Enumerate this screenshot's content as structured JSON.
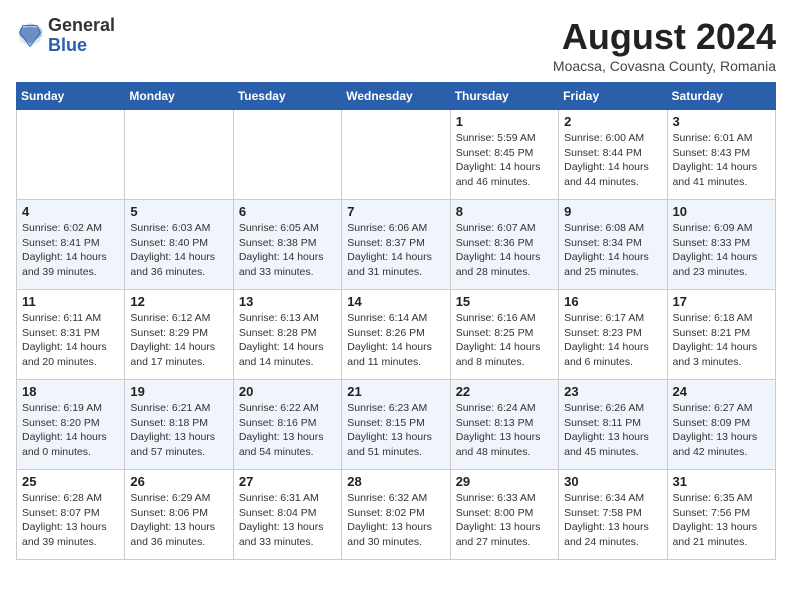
{
  "header": {
    "logo_general": "General",
    "logo_blue": "Blue",
    "title": "August 2024",
    "location": "Moacsa, Covasna County, Romania"
  },
  "weekdays": [
    "Sunday",
    "Monday",
    "Tuesday",
    "Wednesday",
    "Thursday",
    "Friday",
    "Saturday"
  ],
  "weeks": [
    [
      {
        "day": "",
        "info": ""
      },
      {
        "day": "",
        "info": ""
      },
      {
        "day": "",
        "info": ""
      },
      {
        "day": "",
        "info": ""
      },
      {
        "day": "1",
        "info": "Sunrise: 5:59 AM\nSunset: 8:45 PM\nDaylight: 14 hours\nand 46 minutes."
      },
      {
        "day": "2",
        "info": "Sunrise: 6:00 AM\nSunset: 8:44 PM\nDaylight: 14 hours\nand 44 minutes."
      },
      {
        "day": "3",
        "info": "Sunrise: 6:01 AM\nSunset: 8:43 PM\nDaylight: 14 hours\nand 41 minutes."
      }
    ],
    [
      {
        "day": "4",
        "info": "Sunrise: 6:02 AM\nSunset: 8:41 PM\nDaylight: 14 hours\nand 39 minutes."
      },
      {
        "day": "5",
        "info": "Sunrise: 6:03 AM\nSunset: 8:40 PM\nDaylight: 14 hours\nand 36 minutes."
      },
      {
        "day": "6",
        "info": "Sunrise: 6:05 AM\nSunset: 8:38 PM\nDaylight: 14 hours\nand 33 minutes."
      },
      {
        "day": "7",
        "info": "Sunrise: 6:06 AM\nSunset: 8:37 PM\nDaylight: 14 hours\nand 31 minutes."
      },
      {
        "day": "8",
        "info": "Sunrise: 6:07 AM\nSunset: 8:36 PM\nDaylight: 14 hours\nand 28 minutes."
      },
      {
        "day": "9",
        "info": "Sunrise: 6:08 AM\nSunset: 8:34 PM\nDaylight: 14 hours\nand 25 minutes."
      },
      {
        "day": "10",
        "info": "Sunrise: 6:09 AM\nSunset: 8:33 PM\nDaylight: 14 hours\nand 23 minutes."
      }
    ],
    [
      {
        "day": "11",
        "info": "Sunrise: 6:11 AM\nSunset: 8:31 PM\nDaylight: 14 hours\nand 20 minutes."
      },
      {
        "day": "12",
        "info": "Sunrise: 6:12 AM\nSunset: 8:29 PM\nDaylight: 14 hours\nand 17 minutes."
      },
      {
        "day": "13",
        "info": "Sunrise: 6:13 AM\nSunset: 8:28 PM\nDaylight: 14 hours\nand 14 minutes."
      },
      {
        "day": "14",
        "info": "Sunrise: 6:14 AM\nSunset: 8:26 PM\nDaylight: 14 hours\nand 11 minutes."
      },
      {
        "day": "15",
        "info": "Sunrise: 6:16 AM\nSunset: 8:25 PM\nDaylight: 14 hours\nand 8 minutes."
      },
      {
        "day": "16",
        "info": "Sunrise: 6:17 AM\nSunset: 8:23 PM\nDaylight: 14 hours\nand 6 minutes."
      },
      {
        "day": "17",
        "info": "Sunrise: 6:18 AM\nSunset: 8:21 PM\nDaylight: 14 hours\nand 3 minutes."
      }
    ],
    [
      {
        "day": "18",
        "info": "Sunrise: 6:19 AM\nSunset: 8:20 PM\nDaylight: 14 hours\nand 0 minutes."
      },
      {
        "day": "19",
        "info": "Sunrise: 6:21 AM\nSunset: 8:18 PM\nDaylight: 13 hours\nand 57 minutes."
      },
      {
        "day": "20",
        "info": "Sunrise: 6:22 AM\nSunset: 8:16 PM\nDaylight: 13 hours\nand 54 minutes."
      },
      {
        "day": "21",
        "info": "Sunrise: 6:23 AM\nSunset: 8:15 PM\nDaylight: 13 hours\nand 51 minutes."
      },
      {
        "day": "22",
        "info": "Sunrise: 6:24 AM\nSunset: 8:13 PM\nDaylight: 13 hours\nand 48 minutes."
      },
      {
        "day": "23",
        "info": "Sunrise: 6:26 AM\nSunset: 8:11 PM\nDaylight: 13 hours\nand 45 minutes."
      },
      {
        "day": "24",
        "info": "Sunrise: 6:27 AM\nSunset: 8:09 PM\nDaylight: 13 hours\nand 42 minutes."
      }
    ],
    [
      {
        "day": "25",
        "info": "Sunrise: 6:28 AM\nSunset: 8:07 PM\nDaylight: 13 hours\nand 39 minutes."
      },
      {
        "day": "26",
        "info": "Sunrise: 6:29 AM\nSunset: 8:06 PM\nDaylight: 13 hours\nand 36 minutes."
      },
      {
        "day": "27",
        "info": "Sunrise: 6:31 AM\nSunset: 8:04 PM\nDaylight: 13 hours\nand 33 minutes."
      },
      {
        "day": "28",
        "info": "Sunrise: 6:32 AM\nSunset: 8:02 PM\nDaylight: 13 hours\nand 30 minutes."
      },
      {
        "day": "29",
        "info": "Sunrise: 6:33 AM\nSunset: 8:00 PM\nDaylight: 13 hours\nand 27 minutes."
      },
      {
        "day": "30",
        "info": "Sunrise: 6:34 AM\nSunset: 7:58 PM\nDaylight: 13 hours\nand 24 minutes."
      },
      {
        "day": "31",
        "info": "Sunrise: 6:35 AM\nSunset: 7:56 PM\nDaylight: 13 hours\nand 21 minutes."
      }
    ]
  ]
}
